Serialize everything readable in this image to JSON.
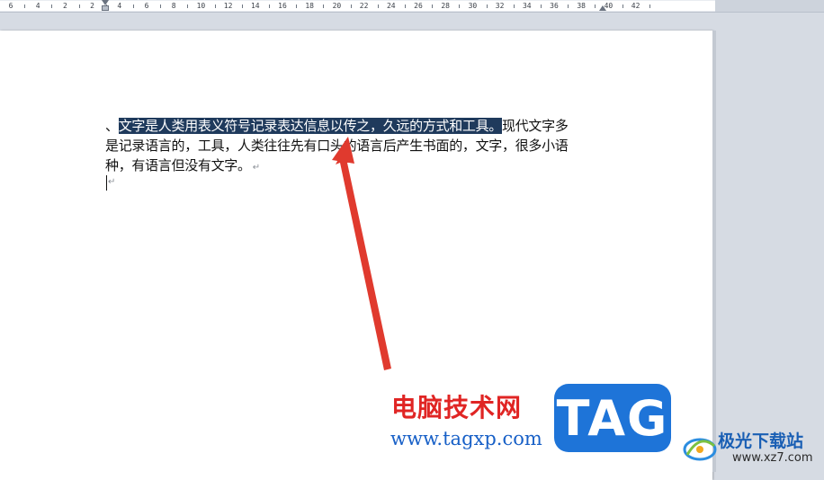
{
  "ruler": {
    "labels": [
      "6",
      "4",
      "2",
      "2",
      "4",
      "6",
      "8",
      "10",
      "12",
      "14",
      "16",
      "18",
      "20",
      "22",
      "24",
      "26",
      "28",
      "30",
      "32",
      "34",
      "36",
      "38",
      "40",
      "42"
    ]
  },
  "document": {
    "line1_prefix": "、",
    "line1_selected": "文字是人类用表义符号记录表达信息以传之，久远的方式和工具。",
    "line1_rest": "现代文字多",
    "line2": "是记录语言的，工具，人类往往先有口头的语言后产生书面的，文字，很多小语",
    "line3": "种，有语言但没有文字。",
    "paragraph_mark": "↵"
  },
  "watermark": {
    "site_name": "电脑技术网",
    "site_url": "www.tagxp.com",
    "logo_text": "TAG",
    "corner_name": "极光下载站",
    "corner_url": "www.xz7.com"
  },
  "colors": {
    "selection": "#1f3a5c",
    "arrow": "#e03a2e",
    "watermark_red": "#e02524",
    "watermark_blue": "#1860c7",
    "tag_blue": "#1e74d8"
  }
}
